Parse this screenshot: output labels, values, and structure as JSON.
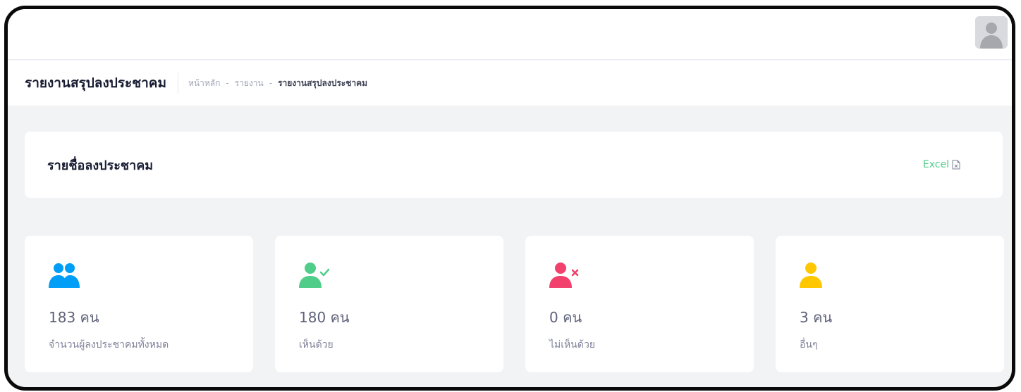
{
  "page": {
    "title": "รายงานสรุปลงประชาคม"
  },
  "breadcrumb": {
    "items": [
      "หน้าหลัก",
      "รายงาน",
      "รายงานสรุปลงประชาคม"
    ],
    "separator": "-"
  },
  "card": {
    "title": "รายชื่อลงประชาคม",
    "excel_label": "Excel",
    "excel_icon": "file-excel-icon"
  },
  "stats": [
    {
      "value": "183 คน",
      "label": "จำนวนผู้ลงประชาคมทั้งหมด",
      "icon": "users-icon",
      "color": "#009ef7"
    },
    {
      "value": "180 คน",
      "label": "เห็นด้วย",
      "icon": "user-check-icon",
      "color": "#50cd89"
    },
    {
      "value": "0 คน",
      "label": "ไม่เห็นด้วย",
      "icon": "user-times-icon",
      "color": "#f1416c"
    },
    {
      "value": "3 คน",
      "label": "อื่นๆ",
      "icon": "user-icon",
      "color": "#ffc700"
    }
  ],
  "colors": {
    "accent_green": "#50cd89",
    "background": "#f2f3f5"
  }
}
